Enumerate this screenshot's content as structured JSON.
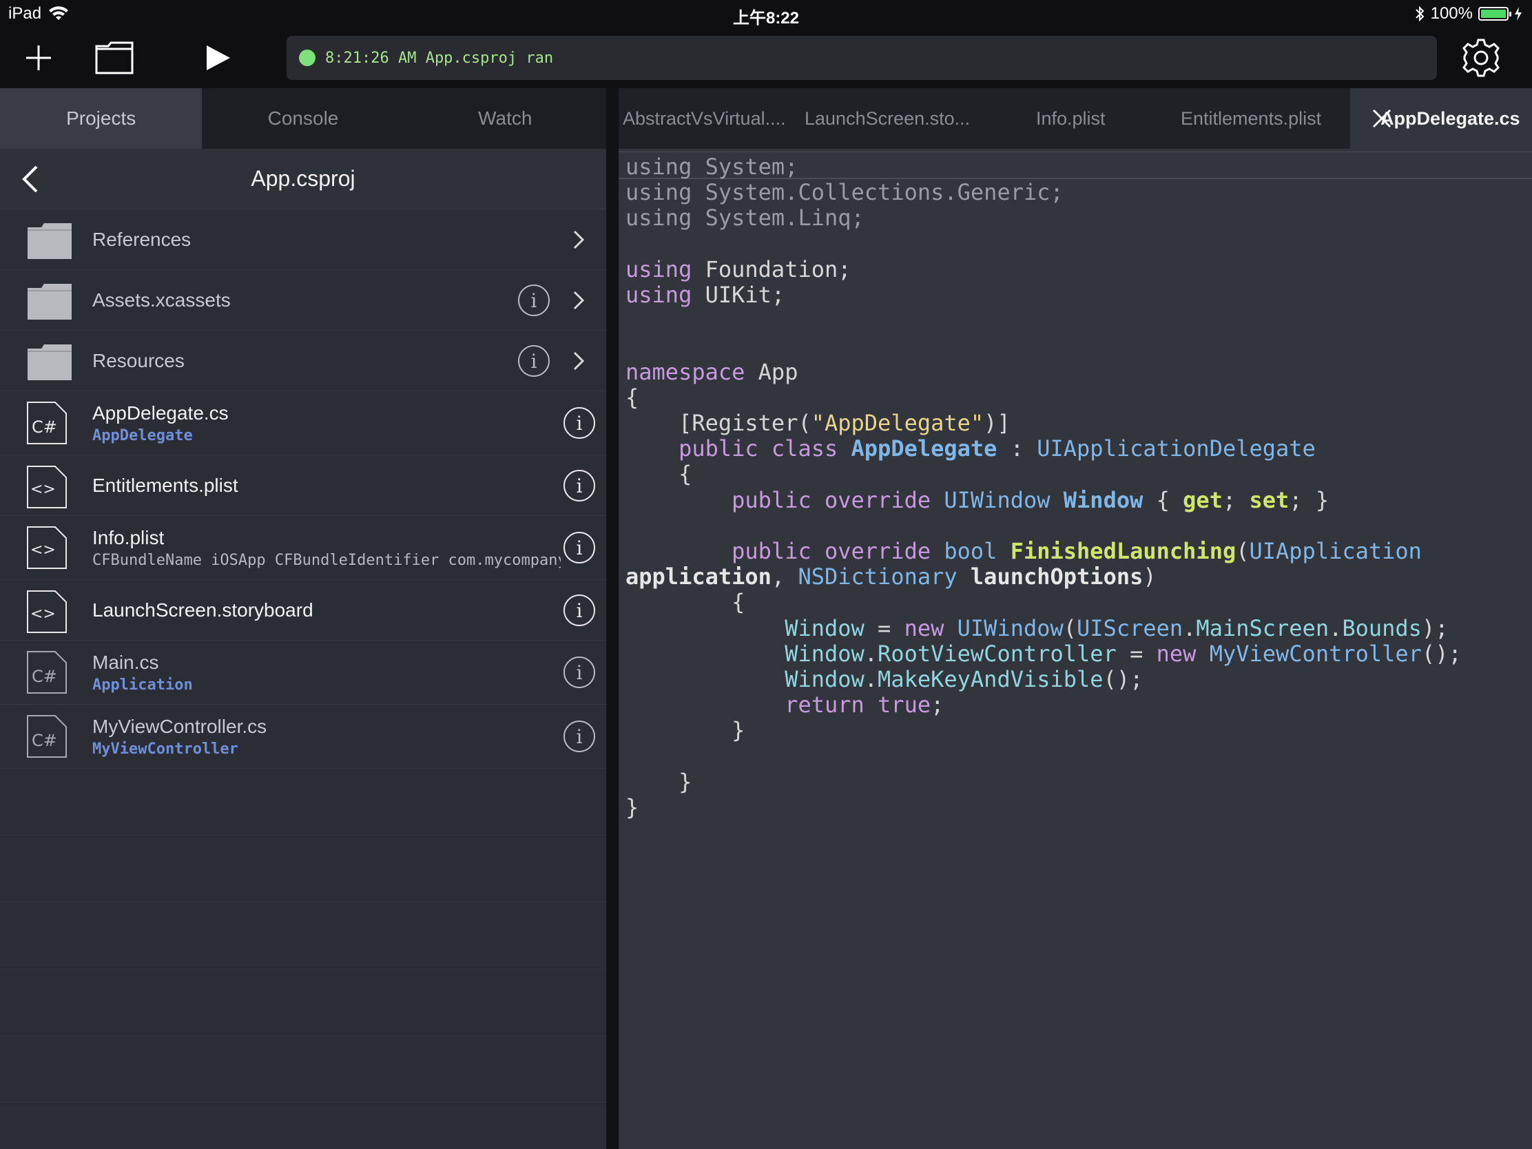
{
  "status_bar": {
    "device": "iPad",
    "time": "上午8:22",
    "battery": "100%"
  },
  "toolbar": {
    "status_message": "8:21:26 AM App.csproj ran",
    "status_color": "#7ee27a"
  },
  "left_tabs": [
    {
      "label": "Projects",
      "active": true
    },
    {
      "label": "Console",
      "active": false
    },
    {
      "label": "Watch",
      "active": false
    }
  ],
  "nav": {
    "title": "App.csproj"
  },
  "files": [
    {
      "name": "References",
      "type": "folder"
    },
    {
      "name": "Assets.xcassets",
      "type": "folder"
    },
    {
      "name": "Resources",
      "type": "folder"
    },
    {
      "name": "AppDelegate.cs",
      "subtitle": "AppDelegate",
      "type": "csharp"
    },
    {
      "name": "Entitlements.plist",
      "type": "xml"
    },
    {
      "name": "Info.plist",
      "subtitle": "CFBundleName iOSApp CFBundleIdentifier com.mycompany",
      "type": "xml"
    },
    {
      "name": "LaunchScreen.storyboard",
      "type": "xml"
    },
    {
      "name": "Main.cs",
      "subtitle": "Application",
      "type": "csharp"
    },
    {
      "name": "MyViewController.cs",
      "subtitle": "MyViewController",
      "type": "csharp"
    }
  ],
  "editor_tabs": [
    {
      "label": "AbstractVsVirtual...."
    },
    {
      "label": "LaunchScreen.sto..."
    },
    {
      "label": "Info.plist"
    },
    {
      "label": "Entitlements.plist"
    },
    {
      "label": "AppDelegate.cs",
      "active": true
    }
  ],
  "code_lines": [
    "using System;",
    "using System.Collections.Generic;",
    "using System.Linq;",
    "",
    "using Foundation;",
    "using UIKit;",
    "",
    "",
    "namespace App",
    "{",
    "    [Register(\"AppDelegate\")]",
    "    public class AppDelegate : UIApplicationDelegate",
    "    {",
    "        public override UIWindow Window { get; set; }",
    "",
    "        public override bool FinishedLaunching(UIApplication",
    "application, NSDictionary launchOptions)",
    "        {",
    "            Window = new UIWindow(UIScreen.MainScreen.Bounds);",
    "            Window.RootViewController = new MyViewController();",
    "            Window.MakeKeyAndVisible();",
    "            return true;",
    "        }",
    "",
    "    }",
    "}"
  ]
}
